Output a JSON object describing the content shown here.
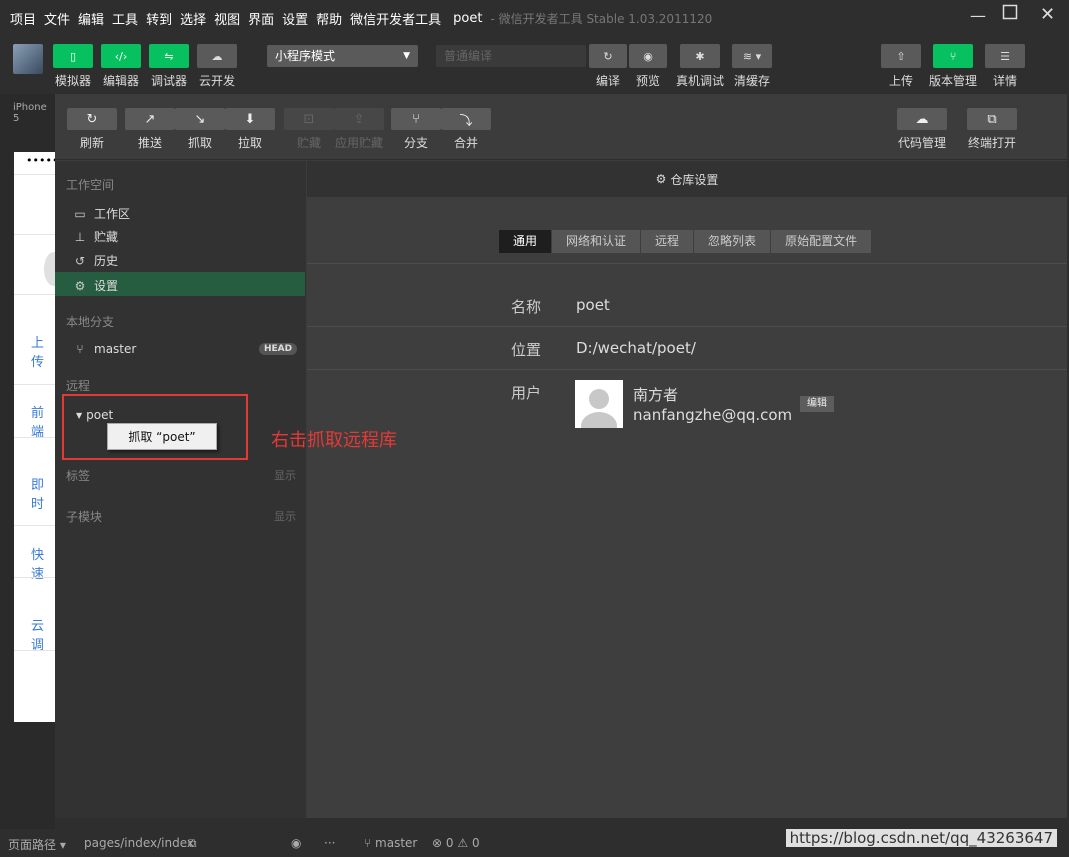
{
  "menubar": {
    "items": [
      "项目",
      "文件",
      "编辑",
      "工具",
      "转到",
      "选择",
      "视图",
      "界面",
      "设置",
      "帮助",
      "微信开发者工具"
    ],
    "project": "poet",
    "app_version": "- 微信开发者工具 Stable 1.03.2011120"
  },
  "toolbar": {
    "left_buttons": [
      {
        "label": "模拟器",
        "icon": "phone-icon"
      },
      {
        "label": "编辑器",
        "icon": "code-icon"
      },
      {
        "label": "调试器",
        "icon": "debug-icon"
      },
      {
        "label": "云开发",
        "icon": "cloud-icon"
      }
    ],
    "mode_select": "小程序模式",
    "compile_select": "普通编译",
    "mid_buttons": [
      {
        "label": "编译",
        "icon": "refresh-icon"
      },
      {
        "label": "预览",
        "icon": "eye-icon"
      },
      {
        "label": "真机调试",
        "icon": "bug-icon"
      },
      {
        "label": "清缓存",
        "icon": "layers-icon"
      }
    ],
    "right_buttons": [
      {
        "label": "上传",
        "icon": "upload-icon"
      },
      {
        "label": "版本管理",
        "icon": "branch-icon"
      },
      {
        "label": "详情",
        "icon": "menu-icon"
      }
    ]
  },
  "simulator": {
    "device": "iPhone 5",
    "signal": "•••••",
    "links": [
      "上传",
      "前端",
      "即时",
      "快速",
      "云调"
    ]
  },
  "vcs_toolbar": {
    "buttons": [
      {
        "label": "刷新",
        "enabled": true
      },
      {
        "label": "推送",
        "enabled": true
      },
      {
        "label": "抓取",
        "enabled": true
      },
      {
        "label": "拉取",
        "enabled": true
      },
      {
        "label": "贮藏",
        "enabled": false
      },
      {
        "label": "应用贮藏",
        "enabled": false
      },
      {
        "label": "分支",
        "enabled": true
      },
      {
        "label": "合并",
        "enabled": true
      }
    ],
    "right_buttons": [
      {
        "label": "代码管理"
      },
      {
        "label": "终端打开"
      }
    ]
  },
  "sidebar": {
    "workspace_title": "工作空间",
    "workspace_items": [
      {
        "label": "工作区",
        "icon": "folder-icon"
      },
      {
        "label": "贮藏",
        "icon": "stash-icon"
      },
      {
        "label": "历史",
        "icon": "history-icon"
      },
      {
        "label": "设置",
        "icon": "gear-icon"
      }
    ],
    "local_title": "本地分支",
    "branch": "master",
    "head_badge": "HEAD",
    "remote_title": "远程",
    "remote_name": "poet",
    "tags_title": "标签",
    "submodules_title": "子模块",
    "show_label": "显示"
  },
  "context_menu": {
    "item": "抓取 “poet”"
  },
  "annotation": "右击抓取远程库",
  "main": {
    "header": "仓库设置",
    "tabs": [
      "通用",
      "网络和认证",
      "远程",
      "忽略列表",
      "原始配置文件"
    ],
    "active_tab": 0,
    "fields": {
      "name_label": "名称",
      "name_value": "poet",
      "path_label": "位置",
      "path_value": "D:/wechat/poet/",
      "user_label": "用户",
      "user_name": "南方者",
      "user_email": "nanfangzhe@qq.com",
      "edit_label": "编辑"
    }
  },
  "statusbar": {
    "page_path_label": "页面路径",
    "page_path": "pages/index/index",
    "branch": "master",
    "errors": "0",
    "warnings": "0"
  },
  "watermark": "https://blog.csdn.net/qq_43263647"
}
